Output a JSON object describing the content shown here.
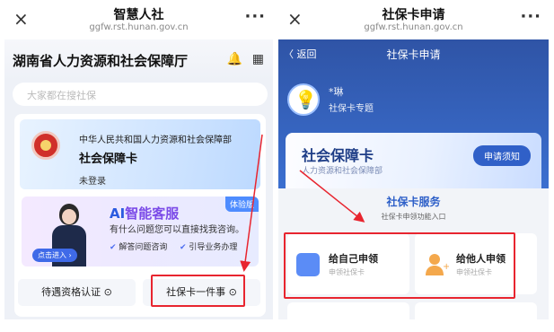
{
  "left": {
    "close_icon": "×",
    "app_title": "智慧人社",
    "app_url": "ggfw.rst.hunan.gov.cn",
    "more_icon": "···",
    "dept_title": "湖南省人力资源和社会保障厅",
    "search_placeholder": "大家都在搜社保",
    "ss_card": {
      "ministry": "中华人民共和国人力资源和社会保障部",
      "name": "社会保障卡",
      "status": "未登录"
    },
    "ai": {
      "title_ai": "AI",
      "title_rest": "智能客服",
      "badge": "体验版",
      "desc": "有什么问题您可以直接找我咨询。",
      "tag1": "解答问题咨询",
      "tag2": "引导业务办理",
      "enter": "点击进入 ›"
    },
    "buttons": {
      "qualification": "待遇资格认证 ⊙",
      "card_one": "社保卡一件事 ⊙"
    }
  },
  "right": {
    "close_icon": "×",
    "app_title": "社保卡申请",
    "app_url": "ggfw.rst.hunan.gov.cn",
    "more_icon": "···",
    "back": "〈 返回",
    "header_title": "社保卡申请",
    "user_name": "*琳",
    "user_topic": "社保卡专题",
    "ss_card": {
      "title": "社会保障卡",
      "subtitle": "人力资源和社会保障部",
      "notice_button": "申请须知"
    },
    "service": {
      "title": "社保卡服务",
      "subtitle": "社保卡申领功能入口",
      "self_label": "给自己申领",
      "self_sub": "申领社保卡",
      "other_label": "给他人申领",
      "other_sub": "申领社保卡"
    }
  },
  "colors": {
    "highlight": "#e8252f",
    "brand_blue": "#2f54a6",
    "accent": "#4e8cff"
  }
}
